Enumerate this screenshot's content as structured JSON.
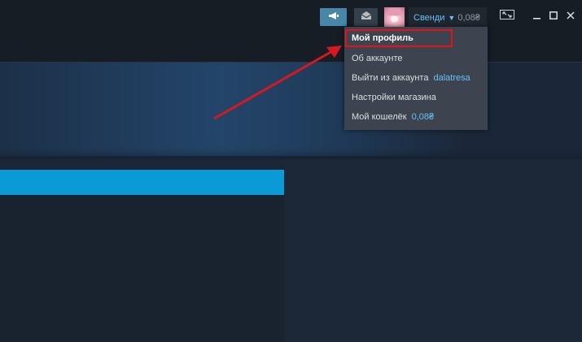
{
  "header": {
    "account_name": "Свенди",
    "wallet_balance": "0,08₴"
  },
  "icons": {
    "announcement": "megaphone-icon",
    "inbox": "envelope-icon",
    "dropdown": "chevron-down-icon",
    "fullscreen": "fullscreen-icon",
    "minimize": "minimize-icon",
    "maximize": "maximize-icon",
    "close": "close-icon"
  },
  "account_menu": {
    "items": [
      {
        "label": "Мой профиль"
      },
      {
        "label": "Об аккаунте"
      },
      {
        "label": "Выйти из аккаунта",
        "extra": "dalatresa"
      },
      {
        "label": "Настройки магазина"
      },
      {
        "label": "Мой кошелёк",
        "extra": "0,08₴"
      }
    ]
  },
  "colors": {
    "accent": "#67c1f5",
    "annotation": "#e0121c",
    "tab_bar": "#0a9ad6"
  }
}
